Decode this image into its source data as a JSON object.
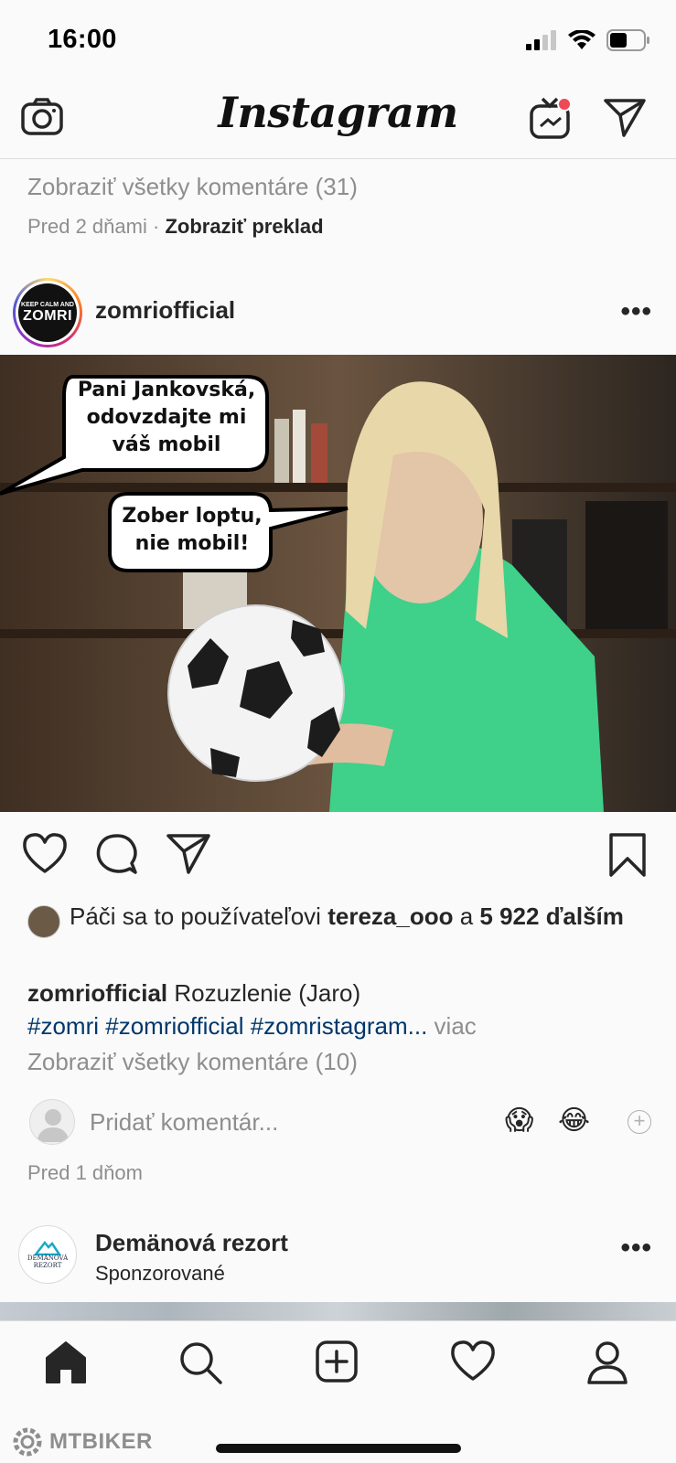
{
  "status": {
    "time": "16:00"
  },
  "topbar": {
    "logo": "Instagram"
  },
  "prev_post": {
    "view_comments": "Zobraziť všetky komentáre (31)",
    "time": "Pred 2 dňami",
    "separator": "·",
    "translate": "Zobraziť preklad"
  },
  "post": {
    "username": "zomriofficial",
    "avatar_text_top": "KEEP CALM AND",
    "avatar_text_main": "ZOMRI",
    "more": "•••",
    "bubble1": "Pani Jankovská, odovzdajte mi váš mobil",
    "bubble2": "Zober loptu, nie mobil!",
    "likes_prefix": "Páči sa to používateľovi",
    "likes_user": "tereza_ooo",
    "likes_and": "a",
    "likes_count": "5 922",
    "likes_suffix": "ďalším",
    "caption_user": "zomriofficial",
    "caption_text": "Rozuzlenie (Jaro)",
    "caption_tags": "#zomri #zomriofficial #zomristagram...",
    "caption_more": "viac",
    "view_all": "Zobraziť všetky komentáre (10)",
    "comment_placeholder": "Pridať komentár...",
    "emoji1": "😱",
    "emoji2": "😂",
    "time": "Pred 1 dňom"
  },
  "ad": {
    "name": "Demänová rezort",
    "sub": "Sponzorované",
    "logo_text1": "DEMÄNOVÁ",
    "logo_text2": "REZORT",
    "more": "•••"
  },
  "watermark": "MTBIKER",
  "colors": {
    "link": "#00376b",
    "muted": "#8e8e8e",
    "notification": "#ed4956",
    "photo_green": "#3fd08a"
  }
}
